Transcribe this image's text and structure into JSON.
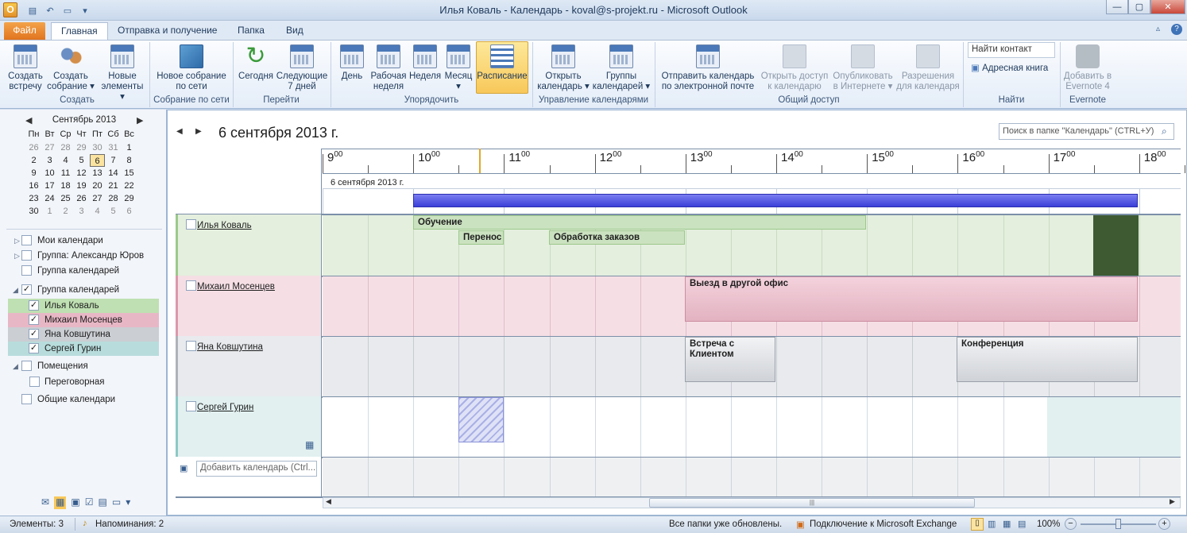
{
  "window": {
    "title": "Илья Коваль - Календарь - koval@s-projekt.ru - Microsoft Outlook",
    "app_icon": "O"
  },
  "tabs": [
    "Файл",
    "Главная",
    "Отправка и получение",
    "Папка",
    "Вид"
  ],
  "ribbon": {
    "buttons": {
      "new_meeting": [
        "Создать",
        "встречу"
      ],
      "new_conf": [
        "Создать",
        "собрание ▾"
      ],
      "new_items": [
        "Новые",
        "элементы ▾"
      ],
      "online_meeting": [
        "Новое собрание",
        "по сети"
      ],
      "today": [
        "Сегодня",
        ""
      ],
      "next7": [
        "Следующие",
        "7 дней"
      ],
      "day": [
        "День",
        ""
      ],
      "workweek": [
        "Рабочая",
        "неделя"
      ],
      "week": [
        "Неделя",
        ""
      ],
      "month": [
        "Месяц ▾",
        ""
      ],
      "schedule": [
        "Расписание",
        ""
      ],
      "open_cal": [
        "Открыть",
        "календарь ▾"
      ],
      "cal_groups": [
        "Группы",
        "календарей ▾"
      ],
      "email_cal": [
        "Отправить календарь",
        "по электронной почте"
      ],
      "share_cal": [
        "Открыть доступ",
        "к календарю"
      ],
      "publish": [
        "Опубликовать",
        "в Интернете ▾"
      ],
      "permissions": [
        "Разрешения",
        "для календаря"
      ],
      "evernote": [
        "Добавить в",
        "Evernote 4"
      ]
    },
    "find_contact_placeholder": "Найти контакт",
    "address_book": "Адресная книга",
    "groups": {
      "create": "Создать",
      "online": "Собрание по сети",
      "goto": "Перейти",
      "arrange": "Упорядочить",
      "manage": "Управление календарями",
      "share": "Общий доступ",
      "find": "Найти",
      "evernote": "Evernote"
    }
  },
  "mini_calendar": {
    "month": "Сентябрь 2013",
    "weekdays": [
      "Пн",
      "Вт",
      "Ср",
      "Чт",
      "Пт",
      "Сб",
      "Вс"
    ],
    "weeks": [
      [
        "26",
        "27",
        "28",
        "29",
        "30",
        "31",
        "1"
      ],
      [
        "2",
        "3",
        "4",
        "5",
        "6",
        "7",
        "8"
      ],
      [
        "9",
        "10",
        "11",
        "12",
        "13",
        "14",
        "15"
      ],
      [
        "16",
        "17",
        "18",
        "19",
        "20",
        "21",
        "22"
      ],
      [
        "23",
        "24",
        "25",
        "26",
        "27",
        "28",
        "29"
      ],
      [
        "30",
        "1",
        "2",
        "3",
        "4",
        "5",
        "6"
      ]
    ],
    "selected": "6"
  },
  "nav": {
    "my_calendars": "Мои календари",
    "group_alexander": "Группа: Александр Юров",
    "group_calendars1": "Группа календарей",
    "group_calendars2": "Группа календарей",
    "members": [
      "Илья Коваль",
      "Михаил Мосенцев",
      "Яна Ковшутина",
      "Сергей Гурин"
    ],
    "rooms": "Помещения",
    "meeting_room": "Переговорная",
    "shared": "Общие календари"
  },
  "schedule": {
    "date_title": "6 сентября 2013 г.",
    "search_placeholder": "Поиск в папке \"Календарь\" (CTRL+У)",
    "hours": [
      "9",
      "10",
      "11",
      "12",
      "13",
      "14",
      "15",
      "16",
      "17",
      "18"
    ],
    "minutes": "00",
    "date_row": "6 сентября 2013 г.",
    "people": [
      "Илья Коваль",
      "Михаил Мосенцев",
      "Яна Ковшутина",
      "Сергей Гурин "
    ],
    "events": {
      "training": "Обучение",
      "transfer": "Перенос",
      "orders": "Обработка заказов",
      "trip": "Выезд в другой офис",
      "client1": "Встреча с",
      "client2": "Клиентом",
      "conference": "Конференция"
    },
    "add_calendar_placeholder": "Добавить календарь (Ctrl..."
  },
  "status": {
    "items": "Элементы: 3",
    "reminders": "Напоминания: 2",
    "updated": "Все папки уже обновлены.",
    "exchange": "Подключение к Microsoft Exchange",
    "zoom": "100%"
  },
  "colors": {
    "green": "#e4efde",
    "pink": "#f5dfe5",
    "gray": "#e8eaed",
    "teal": "#e2f0f0",
    "accent": "#f8c85a"
  }
}
